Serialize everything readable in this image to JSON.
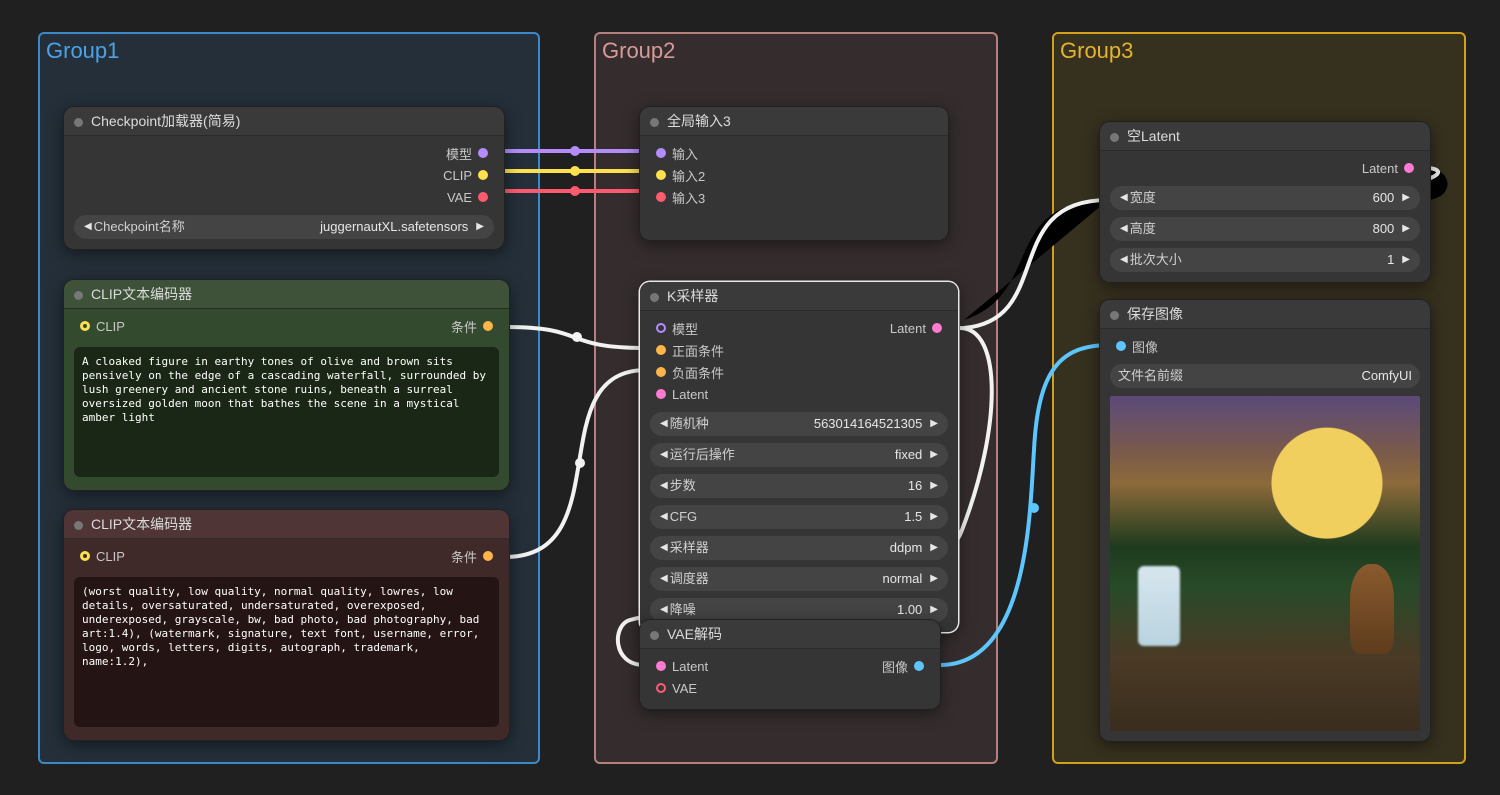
{
  "groups": {
    "g1": "Group1",
    "g2": "Group2",
    "g3": "Group3"
  },
  "ckpt": {
    "title": "Checkpoint加载器(简易)",
    "out_model": "模型",
    "out_clip": "CLIP",
    "out_vae": "VAE",
    "widget_name": "Checkpoint名称",
    "widget_value": "juggernautXL.safetensors"
  },
  "clip_pos": {
    "title": "CLIP文本编码器",
    "in_clip": "CLIP",
    "out_cond": "条件",
    "text": "A cloaked figure in earthy tones of olive and brown sits pensively on the edge of a cascading waterfall, surrounded by lush greenery and ancient stone ruins, beneath a surreal oversized golden moon that bathes the scene in a mystical amber light"
  },
  "clip_neg": {
    "title": "CLIP文本编码器",
    "in_clip": "CLIP",
    "out_cond": "条件",
    "text": "(worst quality, low quality, normal quality, lowres, low details, oversaturated, undersaturated, overexposed, underexposed, grayscale, bw, bad photo, bad photography, bad art:1.4), (watermark, signature, text font, username, error, logo, words, letters, digits, autograph, trademark, name:1.2),"
  },
  "inputs_node": {
    "title": "全局输入3",
    "in1": "输入",
    "in2": "输入2",
    "in3": "输入3"
  },
  "ksampler": {
    "title": "K采样器",
    "in_model": "模型",
    "in_pos": "正面条件",
    "in_neg": "负面条件",
    "in_latent": "Latent",
    "out_latent": "Latent",
    "w_seed_name": "随机种",
    "w_seed_v": "563014164521305",
    "w_after_name": "运行后操作",
    "w_after_v": "fixed",
    "w_steps_name": "步数",
    "w_steps_v": "16",
    "w_cfg_name": "CFG",
    "w_cfg_v": "1.5",
    "w_sampler_name": "采样器",
    "w_sampler_v": "ddpm",
    "w_sched_name": "调度器",
    "w_sched_v": "normal",
    "w_denoise_name": "降噪",
    "w_denoise_v": "1.00"
  },
  "vae_decode": {
    "title": "VAE解码",
    "in_latent": "Latent",
    "in_vae": "VAE",
    "out_image": "图像"
  },
  "empty_latent": {
    "title": "空Latent",
    "out_latent": "Latent",
    "w_width_name": "宽度",
    "w_width_v": "600",
    "w_height_name": "高度",
    "w_height_v": "800",
    "w_batch_name": "批次大小",
    "w_batch_v": "1"
  },
  "save_image": {
    "title": "保存图像",
    "in_image": "图像",
    "w_prefix_name": "文件名前缀",
    "w_prefix_v": "ComfyUI"
  }
}
